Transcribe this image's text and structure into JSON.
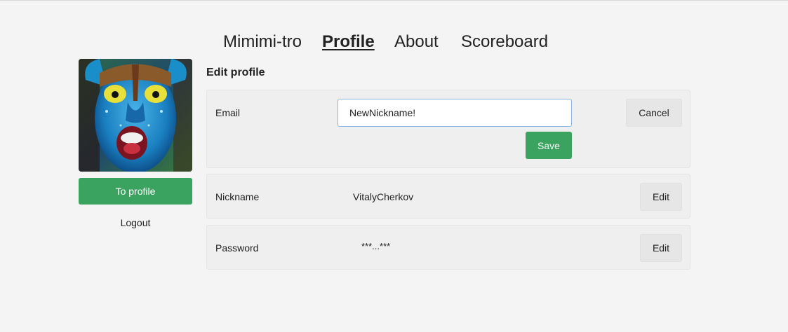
{
  "nav": {
    "items": [
      {
        "label": "Mimimi-tro",
        "active": false
      },
      {
        "label": "Profile",
        "active": true
      },
      {
        "label": "About",
        "active": false
      },
      {
        "label": "Scoreboard",
        "active": false
      }
    ]
  },
  "sidebar": {
    "to_profile_label": "To profile",
    "logout_label": "Logout"
  },
  "main": {
    "title": "Edit profile",
    "email": {
      "label": "Email",
      "input_value": "NewNickname!",
      "cancel_label": "Cancel",
      "save_label": "Save"
    },
    "nickname": {
      "label": "Nickname",
      "value": "VitalyCherkov",
      "edit_label": "Edit"
    },
    "password": {
      "label": "Password",
      "value": "***...***",
      "edit_label": "Edit"
    }
  },
  "colors": {
    "accent_green": "#3aa360",
    "input_focus": "#8ab4e6",
    "background": "#f4f4f4"
  }
}
